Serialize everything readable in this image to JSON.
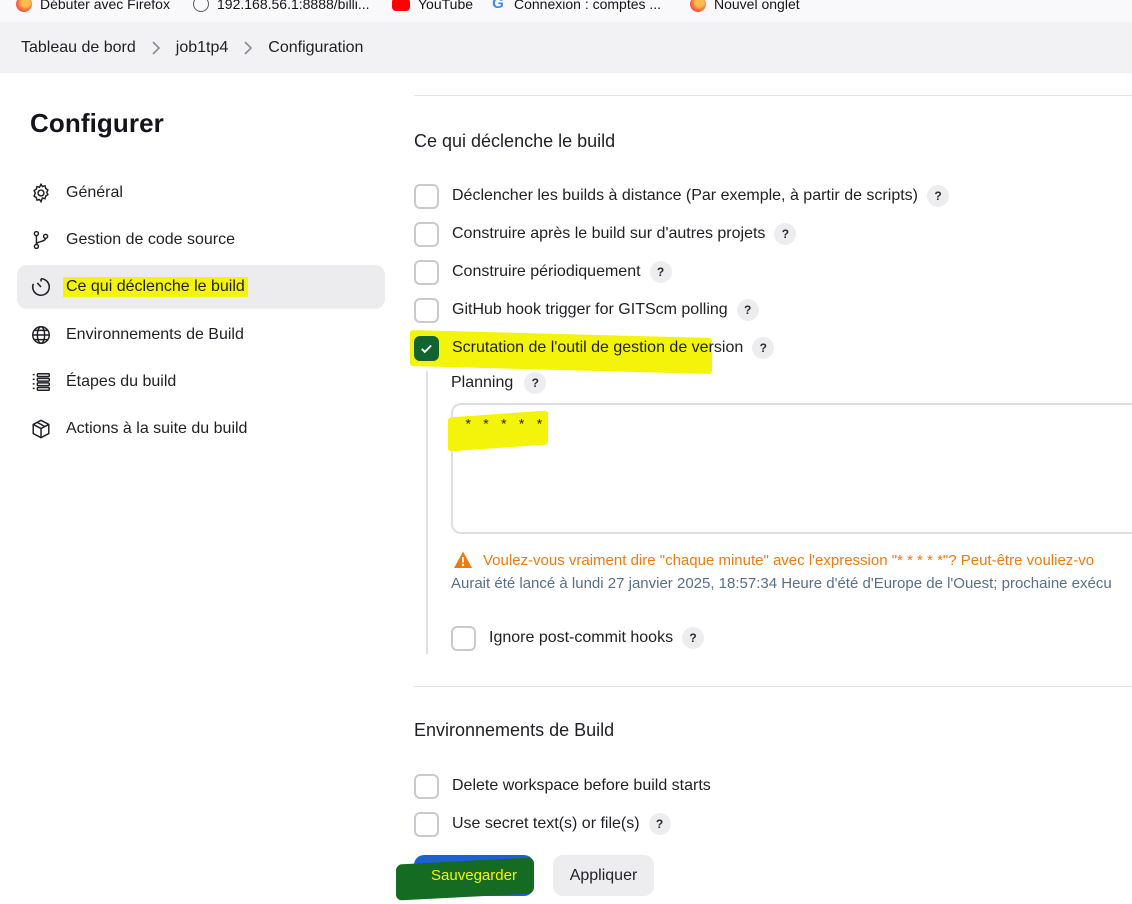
{
  "bookmarks": [
    {
      "label": "Débuter avec Firefox",
      "icon": "firefox-icon"
    },
    {
      "label": "192.168.56.1:8888/billi...",
      "icon": "globe-icon"
    },
    {
      "label": "YouTube",
      "icon": "youtube-icon"
    },
    {
      "label": "Connexion : comptes ...",
      "icon": "google-icon"
    },
    {
      "label": "Nouvel onglet",
      "icon": "firefox-icon"
    }
  ],
  "breadcrumb": [
    "Tableau de bord",
    "job1tp4",
    "Configuration"
  ],
  "sidebar": {
    "title": "Configurer",
    "items": [
      {
        "label": "Général",
        "icon": "gear-icon"
      },
      {
        "label": "Gestion de code source",
        "icon": "branch-icon"
      },
      {
        "label": "Ce qui déclenche le build",
        "icon": "timer-icon",
        "active": true
      },
      {
        "label": "Environnements de Build",
        "icon": "globe-icon"
      },
      {
        "label": "Étapes du build",
        "icon": "list-icon"
      },
      {
        "label": "Actions à la suite du build",
        "icon": "package-icon"
      }
    ]
  },
  "triggers": {
    "title": "Ce qui déclenche le build",
    "options": [
      {
        "label": "Déclencher les builds à distance (Par exemple, à partir de scripts)",
        "checked": false
      },
      {
        "label": "Construire après le build sur d'autres projets",
        "checked": false
      },
      {
        "label": "Construire périodiquement",
        "checked": false
      },
      {
        "label": "GitHub hook trigger for GITScm polling",
        "checked": false
      },
      {
        "label": "Scrutation de l'outil de gestion de version",
        "checked": true
      }
    ],
    "planning": {
      "label": "Planning",
      "value": "* * * * *",
      "warning": "Voulez-vous vraiment dire \"chaque minute\" avec l'expression  \"* * * * *\"? Peut-être vouliez-vo",
      "info": "Aurait été lancé à lundi 27 janvier 2025, 18:57:34 Heure d'été d'Europe de l'Ouest; prochaine exécu"
    },
    "ignore_hooks": {
      "label": "Ignore post-commit hooks",
      "checked": false
    }
  },
  "build_env": {
    "title": "Environnements de Build",
    "options": [
      {
        "label": "Delete workspace before build starts",
        "checked": false,
        "help": false
      },
      {
        "label": "Use secret text(s) or file(s)",
        "checked": false,
        "help": true
      }
    ]
  },
  "actions": {
    "save_label": "Sauvegarder",
    "apply_label": "Appliquer"
  },
  "help_label": "?",
  "colors": {
    "accent": "#1f5fd6",
    "checked": "#136331",
    "warning": "#ee7b0f",
    "highlight": "#f4f40a"
  }
}
